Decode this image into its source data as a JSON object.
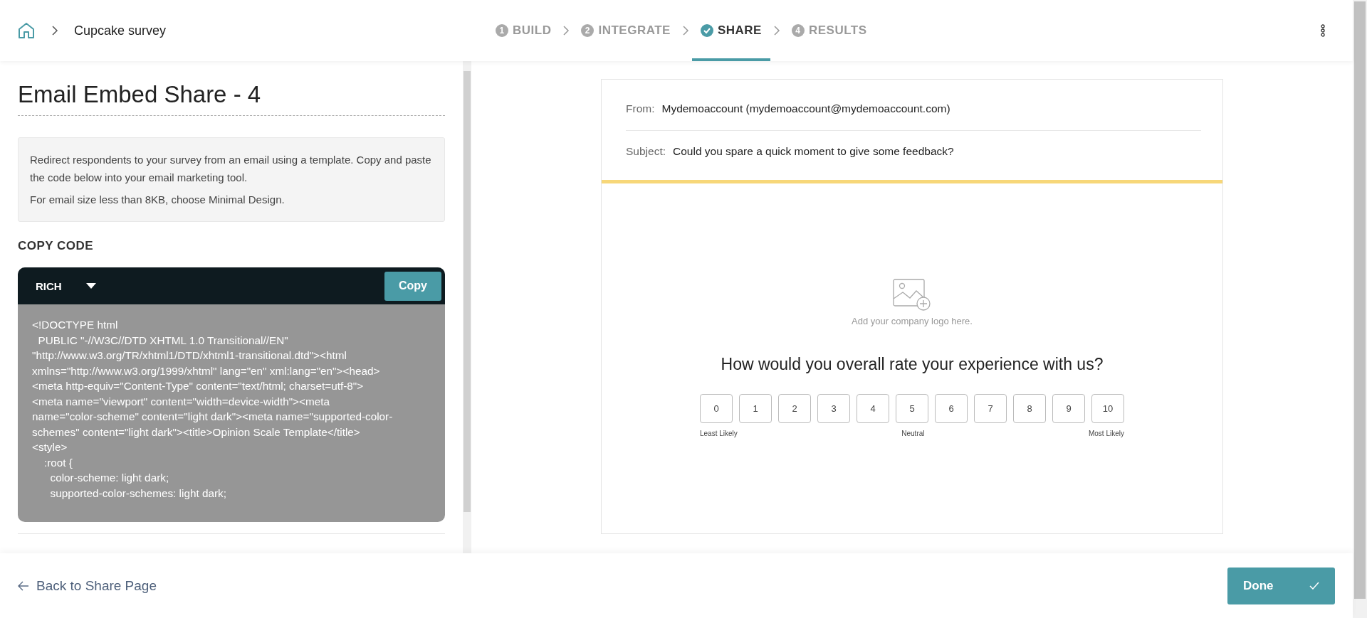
{
  "breadcrumb": {
    "title": "Cupcake survey"
  },
  "steps": [
    {
      "number": "1",
      "label": "BUILD",
      "selected": false
    },
    {
      "number": "2",
      "label": "INTEGRATE",
      "selected": false
    },
    {
      "label": "SHARE",
      "selected": true
    },
    {
      "number": "4",
      "label": "RESULTS",
      "selected": false
    }
  ],
  "panel": {
    "title": "Email Embed Share - 4",
    "info": [
      "Redirect respondents to your survey from an email using a template. Copy and paste the code below into your email marketing tool.",
      "For email size less than 8KB, choose Minimal Design."
    ],
    "section_title": "COPY CODE",
    "format": "RICH",
    "copy_button": "Copy",
    "code_lines": [
      "<!DOCTYPE html",
      "  PUBLIC \"-//W3C//DTD XHTML 1.0 Transitional//EN\"",
      "\"http://www.w3.org/TR/xhtml1/DTD/xhtml1-transitional.dtd\"><html",
      "xmlns=\"http://www.w3.org/1999/xhtml\" lang=\"en\" xml:lang=\"en\"><head>",
      "<meta http-equiv=\"Content-Type\" content=\"text/html; charset=utf-8\">",
      "<meta name=\"viewport\" content=\"width=device-width\"><meta",
      "name=\"color-scheme\" content=\"light dark\"><meta name=\"supported-color-",
      "schemes\" content=\"light dark\"><title>Opinion Scale Template</title>",
      "<style>",
      "    :root {",
      "      color-scheme: light dark;",
      "      supported-color-schemes: light dark;"
    ]
  },
  "email": {
    "from_label": "From:",
    "from": "Mydemoaccount (mydemoaccount@mydemoaccount.com)",
    "subject_label": "Subject:",
    "subject": "Could you spare a quick moment to give some feedback?",
    "logo_hint": "Add your company logo here.",
    "question": "How would you overall rate your experience with us?",
    "scale": [
      "0",
      "1",
      "2",
      "3",
      "4",
      "5",
      "6",
      "7",
      "8",
      "9",
      "10"
    ],
    "scale_labels": [
      "Least Likely",
      "Neutral",
      "Most Likely"
    ]
  },
  "footer": {
    "back": "Back to Share Page",
    "done": "Done"
  }
}
